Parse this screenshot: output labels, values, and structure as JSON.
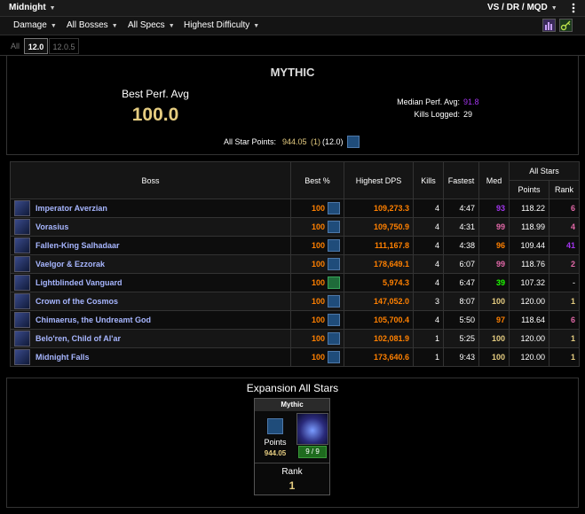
{
  "topbar": {
    "title": "Midnight",
    "right_label": "VS / DR / MQD"
  },
  "filters": [
    "Damage",
    "All Bosses",
    "All Specs",
    "Highest Difficulty"
  ],
  "tabs": [
    {
      "label": "All",
      "active": false
    },
    {
      "label": "12.0",
      "active": true
    },
    {
      "label": "12.0.5",
      "active": false
    }
  ],
  "summary": {
    "difficulty": "MYTHIC",
    "best_perf_label": "Best Perf. Avg",
    "best_perf_value": "100.0",
    "median_label": "Median Perf. Avg:",
    "median_value": "91.8",
    "kills_label": "Kills Logged:",
    "kills_value": "29",
    "allstar_label": "All Star Points:",
    "allstar_value": "944.05",
    "allstar_rank": "(1)",
    "allstar_patch": "(12.0)"
  },
  "table": {
    "headers": {
      "boss": "Boss",
      "best": "Best %",
      "dps": "Highest DPS",
      "kills": "Kills",
      "fastest": "Fastest",
      "med": "Med",
      "allstars": "All Stars",
      "points": "Points",
      "rank": "Rank"
    },
    "rows": [
      {
        "boss": "Imperator Averzian",
        "best": "100",
        "dps": "109,273.3",
        "kills": "4",
        "fastest": "4:47",
        "med": "93",
        "points": "118.22",
        "rank": "6",
        "spec": "blue",
        "med_color": "purple",
        "rank_color": "pink"
      },
      {
        "boss": "Vorasius",
        "best": "100",
        "dps": "109,750.9",
        "kills": "4",
        "fastest": "4:31",
        "med": "99",
        "points": "118.99",
        "rank": "4",
        "spec": "blue",
        "med_color": "pink",
        "rank_color": "pink"
      },
      {
        "boss": "Fallen-King Salhadaar",
        "best": "100",
        "dps": "111,167.8",
        "kills": "4",
        "fastest": "4:38",
        "med": "96",
        "points": "109.44",
        "rank": "41",
        "spec": "blue",
        "med_color": "orange",
        "rank_color": "purple"
      },
      {
        "boss": "Vaelgor & Ezzorak",
        "best": "100",
        "dps": "178,649.1",
        "kills": "4",
        "fastest": "6:07",
        "med": "99",
        "points": "118.76",
        "rank": "2",
        "spec": "blue",
        "med_color": "pink",
        "rank_color": "pink"
      },
      {
        "boss": "Lightblinded Vanguard",
        "best": "100",
        "dps": "5,974.3",
        "kills": "4",
        "fastest": "6:47",
        "med": "39",
        "points": "107.32",
        "rank": "-",
        "spec": "green",
        "med_color": "green",
        "rank_color": "none"
      },
      {
        "boss": "Crown of the Cosmos",
        "best": "100",
        "dps": "147,052.0",
        "kills": "3",
        "fastest": "8:07",
        "med": "100",
        "points": "120.00",
        "rank": "1",
        "spec": "blue",
        "med_color": "gold",
        "rank_color": "gold"
      },
      {
        "boss": "Chimaerus, the Undreamt God",
        "best": "100",
        "dps": "105,700.4",
        "kills": "4",
        "fastest": "5:50",
        "med": "97",
        "points": "118.64",
        "rank": "6",
        "spec": "blue",
        "med_color": "orange",
        "rank_color": "pink"
      },
      {
        "boss": "Belo'ren, Child of Al'ar",
        "best": "100",
        "dps": "102,081.9",
        "kills": "1",
        "fastest": "5:25",
        "med": "100",
        "points": "120.00",
        "rank": "1",
        "spec": "blue",
        "med_color": "gold",
        "rank_color": "gold"
      },
      {
        "boss": "Midnight Falls",
        "best": "100",
        "dps": "173,640.6",
        "kills": "1",
        "fastest": "9:43",
        "med": "100",
        "points": "120.00",
        "rank": "1",
        "spec": "blue",
        "med_color": "gold",
        "rank_color": "gold"
      }
    ]
  },
  "expansion": {
    "title": "Expansion All Stars",
    "card_title": "Mythic",
    "points_label": "Points",
    "points_value": "944.05",
    "progress": "9 / 9",
    "rank_label": "Rank",
    "rank_value": "1"
  },
  "colors": {
    "gold": "#e5cc80",
    "orange": "#ff8000",
    "purple": "#a335ee",
    "pink": "#e268a8",
    "green": "#1eff00",
    "boss_link": "#a7b6ff"
  }
}
